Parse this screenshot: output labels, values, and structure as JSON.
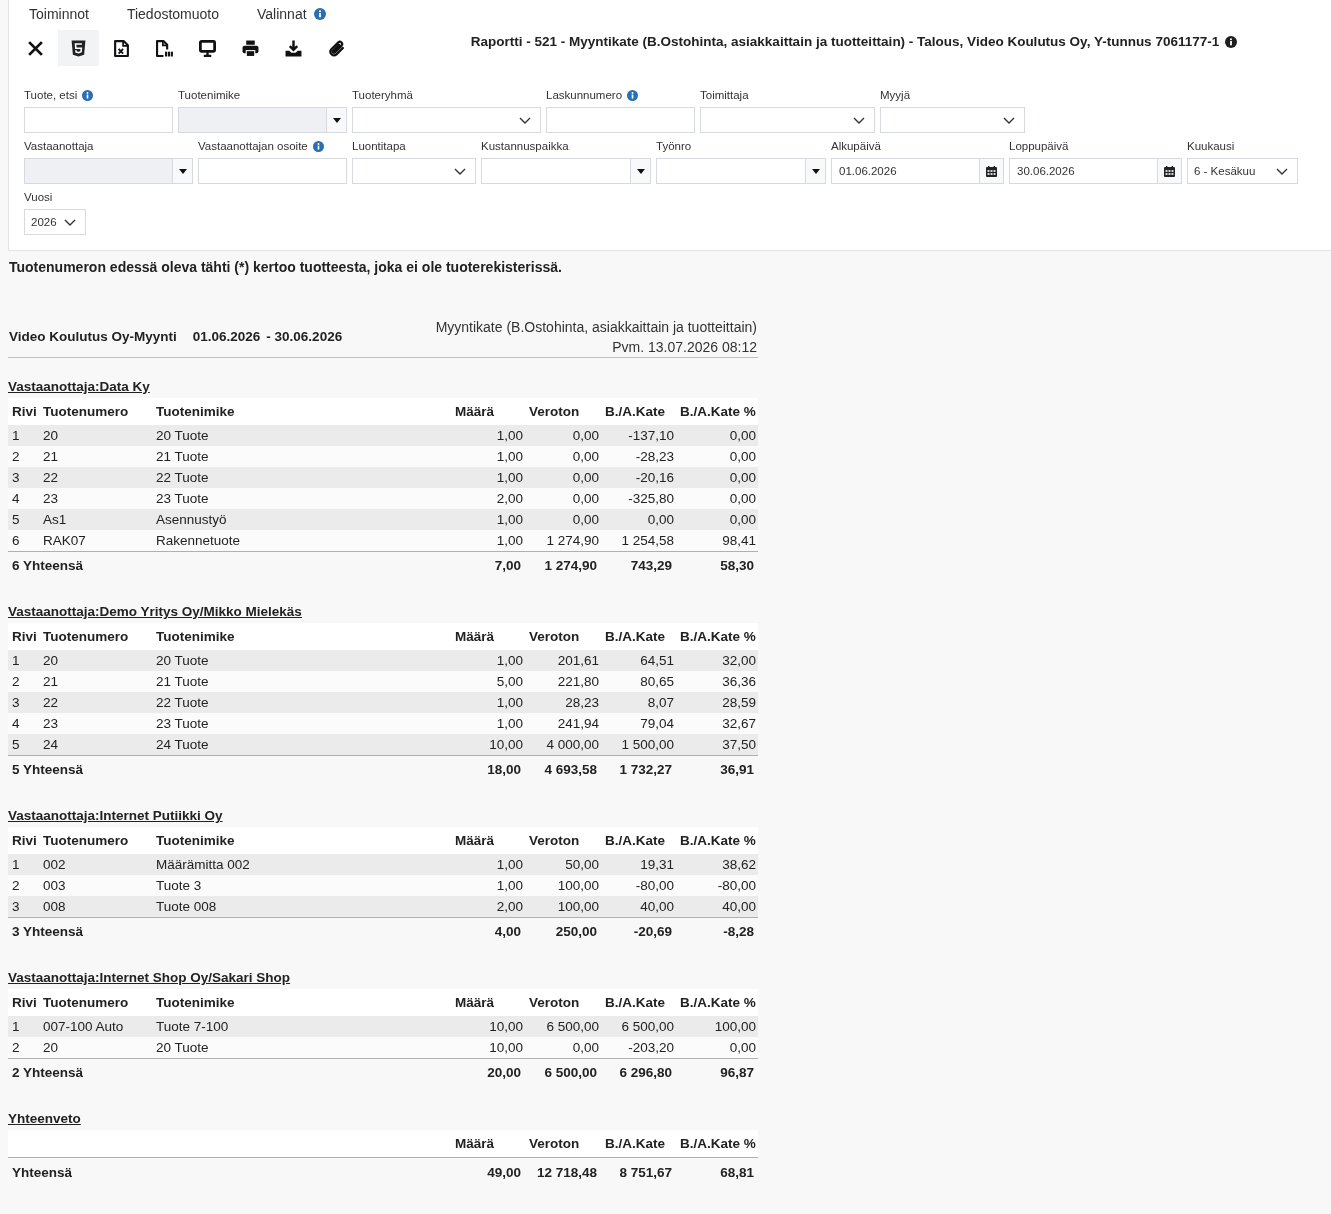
{
  "menu": [
    {
      "label": "Toiminnot",
      "info": false
    },
    {
      "label": "Tiedostomuoto",
      "info": false
    },
    {
      "label": "Valinnat",
      "info": true
    }
  ],
  "toolbar": [
    {
      "kind": "close",
      "selected": false
    },
    {
      "kind": "html",
      "selected": true
    },
    {
      "kind": "excel",
      "selected": false
    },
    {
      "kind": "pdf",
      "selected": false
    },
    {
      "kind": "screen",
      "selected": false
    },
    {
      "kind": "print",
      "selected": false
    },
    {
      "kind": "download",
      "selected": false
    },
    {
      "kind": "attach",
      "selected": false
    }
  ],
  "report_title": {
    "text": "Raportti - 521 - Myyntikate (B.Ostohinta, asiakkaittain ja tuotteittain) - Talous, Video Koulutus Oy, Y-tunnus 7061177-1",
    "info": true
  },
  "filter_rows": [
    [
      {
        "label": "Tuote, etsi",
        "info": true,
        "kind": "text",
        "disabled": false
      },
      {
        "label": "Tuotenimike",
        "info": false,
        "kind": "combo",
        "disabled": true
      },
      {
        "label": "Tuoteryhmä",
        "info": false,
        "kind": "select",
        "disabled": false
      },
      {
        "label": "Laskunnumero",
        "info": true,
        "kind": "text",
        "disabled": false
      },
      {
        "label": "Toimittaja",
        "info": false,
        "kind": "select",
        "disabled": false
      },
      {
        "label": "Myyjä",
        "info": false,
        "kind": "select",
        "disabled": false
      }
    ],
    [
      {
        "label": "Vastaanottaja",
        "info": false,
        "kind": "combo",
        "disabled": true
      },
      {
        "label": "Vastaanottajan osoite",
        "info": true,
        "kind": "text",
        "disabled": false
      },
      {
        "label": "Luontitapa",
        "info": false,
        "kind": "select",
        "disabled": false
      },
      {
        "label": "Kustannuspaikka",
        "info": false,
        "kind": "combo",
        "disabled": false
      },
      {
        "label": "Työnro",
        "info": false,
        "kind": "combo",
        "disabled": false
      },
      {
        "label": "Alkupäivä",
        "info": false,
        "kind": "date",
        "disabled": false,
        "value": "01.06.2026"
      },
      {
        "label": "Loppupäivä",
        "info": false,
        "kind": "date",
        "disabled": false,
        "value": "30.06.2026"
      },
      {
        "label": "Kuukausi",
        "info": false,
        "kind": "select",
        "disabled": false,
        "value": "6 - Kesäkuu"
      }
    ],
    [
      {
        "label": "Vuosi",
        "info": false,
        "kind": "select",
        "disabled": false,
        "value": "2026"
      }
    ]
  ],
  "note": "Tuotenumeron edessä oleva tähti (*) kertoo tuotteesta, joka ei ole tuoterekisterissä.",
  "report_header": {
    "company": "Video Koulutus Oy-Myynti",
    "start_date": "01.06.2026",
    "end_date": "- 30.06.2026",
    "title": "Myyntikate (B.Ostohinta, asiakkaittain ja tuotteittain)",
    "printed": "Pvm. 13.07.2026 08:12"
  },
  "groups": [
    {
      "heading": "Vastaanottaja:Data Ky",
      "columns": [
        "Rivi",
        "Tuotenumero",
        "Tuotenimike",
        "Määrä",
        "Veroton",
        "B./A.Kate",
        "B./A.Kate %"
      ],
      "rows": [
        [
          "1",
          "20",
          "20 Tuote",
          "1,00",
          "0,00",
          "-137,10",
          "0,00"
        ],
        [
          "2",
          "21",
          "21 Tuote",
          "1,00",
          "0,00",
          "-28,23",
          "0,00"
        ],
        [
          "3",
          "22",
          "22 Tuote",
          "1,00",
          "0,00",
          "-20,16",
          "0,00"
        ],
        [
          "4",
          "23",
          "23 Tuote",
          "2,00",
          "0,00",
          "-325,80",
          "0,00"
        ],
        [
          "5",
          "As1",
          "Asennustyö",
          "1,00",
          "0,00",
          "0,00",
          "0,00"
        ],
        [
          "6",
          "RAK07",
          "Rakennetuote",
          "1,00",
          "1 274,90",
          "1 254,58",
          "98,41"
        ]
      ],
      "total": {
        "label": "6 Yhteensä",
        "values": [
          "7,00",
          "1 274,90",
          "743,29",
          "58,30"
        ]
      }
    },
    {
      "heading": "Vastaanottaja:Demo Yritys Oy/Mikko Mielekäs",
      "columns": [
        "Rivi",
        "Tuotenumero",
        "Tuotenimike",
        "Määrä",
        "Veroton",
        "B./A.Kate",
        "B./A.Kate %"
      ],
      "rows": [
        [
          "1",
          "20",
          "20 Tuote",
          "1,00",
          "201,61",
          "64,51",
          "32,00"
        ],
        [
          "2",
          "21",
          "21 Tuote",
          "5,00",
          "221,80",
          "80,65",
          "36,36"
        ],
        [
          "3",
          "22",
          "22 Tuote",
          "1,00",
          "28,23",
          "8,07",
          "28,59"
        ],
        [
          "4",
          "23",
          "23 Tuote",
          "1,00",
          "241,94",
          "79,04",
          "32,67"
        ],
        [
          "5",
          "24",
          "24 Tuote",
          "10,00",
          "4 000,00",
          "1 500,00",
          "37,50"
        ]
      ],
      "total": {
        "label": "5 Yhteensä",
        "values": [
          "18,00",
          "4 693,58",
          "1 732,27",
          "36,91"
        ]
      }
    },
    {
      "heading": "Vastaanottaja:Internet Putiikki Oy",
      "columns": [
        "Rivi",
        "Tuotenumero",
        "Tuotenimike",
        "Määrä",
        "Veroton",
        "B./A.Kate",
        "B./A.Kate %"
      ],
      "rows": [
        [
          "1",
          "002",
          "Määrämitta 002",
          "1,00",
          "50,00",
          "19,31",
          "38,62"
        ],
        [
          "2",
          "003",
          "Tuote 3",
          "1,00",
          "100,00",
          "-80,00",
          "-80,00"
        ],
        [
          "3",
          "008",
          "Tuote 008",
          "2,00",
          "100,00",
          "40,00",
          "40,00"
        ]
      ],
      "total": {
        "label": "3 Yhteensä",
        "values": [
          "4,00",
          "250,00",
          "-20,69",
          "-8,28"
        ]
      }
    },
    {
      "heading": "Vastaanottaja:Internet Shop Oy/Sakari Shop",
      "columns": [
        "Rivi",
        "Tuotenumero",
        "Tuotenimike",
        "Määrä",
        "Veroton",
        "B./A.Kate",
        "B./A.Kate %"
      ],
      "rows": [
        [
          "1",
          "007-100 Auto",
          "Tuote 7-100",
          "10,00",
          "6 500,00",
          "6 500,00",
          "100,00"
        ],
        [
          "2",
          "20",
          "20 Tuote",
          "10,00",
          "0,00",
          "-203,20",
          "0,00"
        ]
      ],
      "total": {
        "label": "2 Yhteensä",
        "values": [
          "20,00",
          "6 500,00",
          "6 296,80",
          "96,87"
        ]
      }
    }
  ],
  "summary": {
    "heading": "Yhteenveto",
    "columns": [
      "Määrä",
      "Veroton",
      "B./A.Kate",
      "B./A.Kate %"
    ],
    "total": {
      "label": "Yhteensä",
      "values": [
        "49,00",
        "12 718,48",
        "8 751,67",
        "68,81"
      ]
    }
  }
}
